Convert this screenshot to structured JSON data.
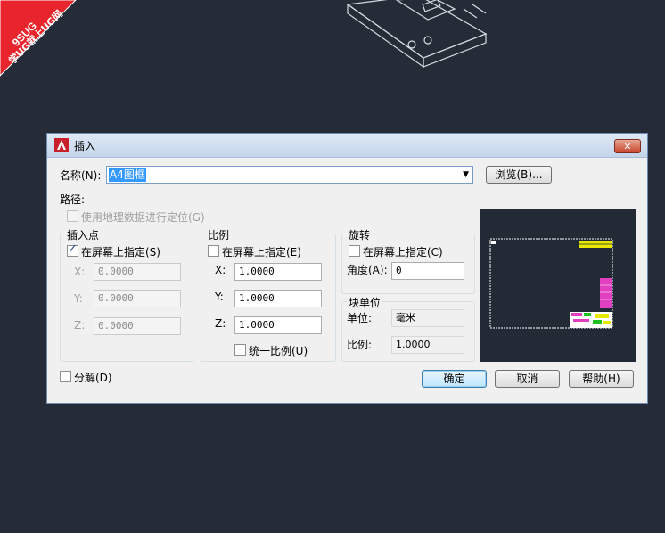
{
  "watermark": {
    "line1": "9SUG",
    "line2": "学UG就上UG网",
    "color": "#e8242c"
  },
  "dialog": {
    "title": "插入",
    "name_label": "名称(N):",
    "name_value": "A4图框",
    "browse_label": "浏览(B)...",
    "path_label": "路径:",
    "geo_label": "使用地理数据进行定位(G)",
    "insert_point": {
      "title": "插入点",
      "on_screen_label": "在屏幕上指定(S)",
      "on_screen_checked": true,
      "x_label": "X:",
      "x_value": "0.0000",
      "y_label": "Y:",
      "y_value": "0.0000",
      "z_label": "Z:",
      "z_value": "0.0000"
    },
    "scale": {
      "title": "比例",
      "on_screen_label": "在屏幕上指定(E)",
      "on_screen_checked": false,
      "x_label": "X:",
      "x_value": "1.0000",
      "y_label": "Y:",
      "y_value": "1.0000",
      "z_label": "Z:",
      "z_value": "1.0000",
      "uniform_label": "统一比例(U)",
      "uniform_checked": false
    },
    "rotation": {
      "title": "旋转",
      "on_screen_label": "在屏幕上指定(C)",
      "on_screen_checked": false,
      "angle_label": "角度(A):",
      "angle_value": "0"
    },
    "block_unit": {
      "title": "块单位",
      "unit_label": "单位:",
      "unit_value": "毫米",
      "factor_label": "比例:",
      "factor_value": "1.0000"
    },
    "explode_label": "分解(D)",
    "explode_checked": false,
    "ok_label": "确定",
    "cancel_label": "取消",
    "help_label": "帮助(H)",
    "close_symbol": "✕"
  },
  "colors": {
    "background": "#252c37",
    "selection": "#3399ff",
    "app_icon": "#c8202a"
  }
}
